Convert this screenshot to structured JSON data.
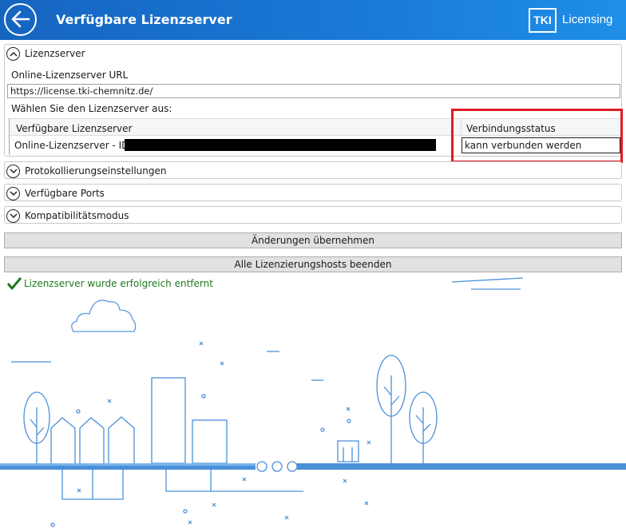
{
  "header": {
    "title": "Verfügbare Lizenzserver",
    "logo_mark": "TKI",
    "logo_text": "Licensing"
  },
  "panels": {
    "lizenzserver": {
      "title": "Lizenzserver",
      "url_label": "Online-Lizenzserver URL",
      "url_value": "https://license.tki-chemnitz.de/",
      "select_label": "Wählen Sie den Lizenzserver aus:",
      "grid": {
        "columns": [
          "Verfügbare Lizenzserver",
          "Verbindungsstatus"
        ],
        "rows": [
          {
            "server": "Online-Lizenzserver - ID",
            "status": "kann verbunden werden"
          }
        ]
      }
    },
    "protokoll": {
      "title": "Protokollierungseinstellungen"
    },
    "ports": {
      "title": "Verfügbare Ports"
    },
    "kompat": {
      "title": "Kompatibilitätsmodus"
    }
  },
  "buttons": {
    "apply": "Änderungen übernehmen",
    "stop_all": "Alle Lizenzierungshosts beenden"
  },
  "status_message": "Lizenzserver wurde erfolgreich entfernt",
  "colors": {
    "header_blue": "#1565c0",
    "highlight_red": "#e01b24",
    "success_green": "#1d7a1d",
    "illustration_blue": "#4a90d9"
  },
  "icons": [
    "back-arrow-icon",
    "chevron-up-icon",
    "chevron-down-icon",
    "checkmark-icon"
  ]
}
